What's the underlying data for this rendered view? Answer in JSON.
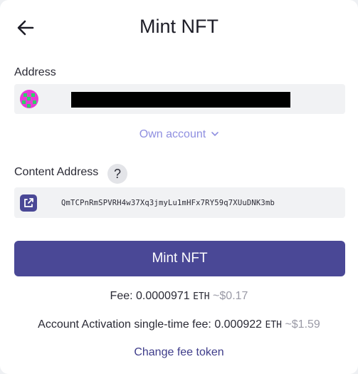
{
  "header": {
    "title": "Mint NFT"
  },
  "address": {
    "label": "Address",
    "own_account_label": "Own account"
  },
  "content": {
    "label": "Content Address",
    "help_symbol": "?",
    "hash": "QmTCPnRmSPVRH4w37Xq3jmyLu1mHFx7RY59q7XUuDNK3mb"
  },
  "mint_button_label": "Mint NFT",
  "fee": {
    "label": "Fee:",
    "amount": "0.0000971",
    "unit": "ETH",
    "usd": "~$0.17"
  },
  "activation_fee": {
    "label": "Account Activation single-time fee:",
    "amount": "0.000922",
    "unit": "ETH",
    "usd": "~$1.59"
  },
  "change_fee_token_label": "Change fee token",
  "icons": {
    "back": "arrow-left-icon",
    "chevron": "chevron-down-icon",
    "help": "question-icon",
    "external_link": "external-link-icon",
    "avatar": "identicon-avatar"
  },
  "colors": {
    "accent": "#4a4896",
    "link": "#8f8fe0",
    "field_bg": "#f1f2f4"
  }
}
